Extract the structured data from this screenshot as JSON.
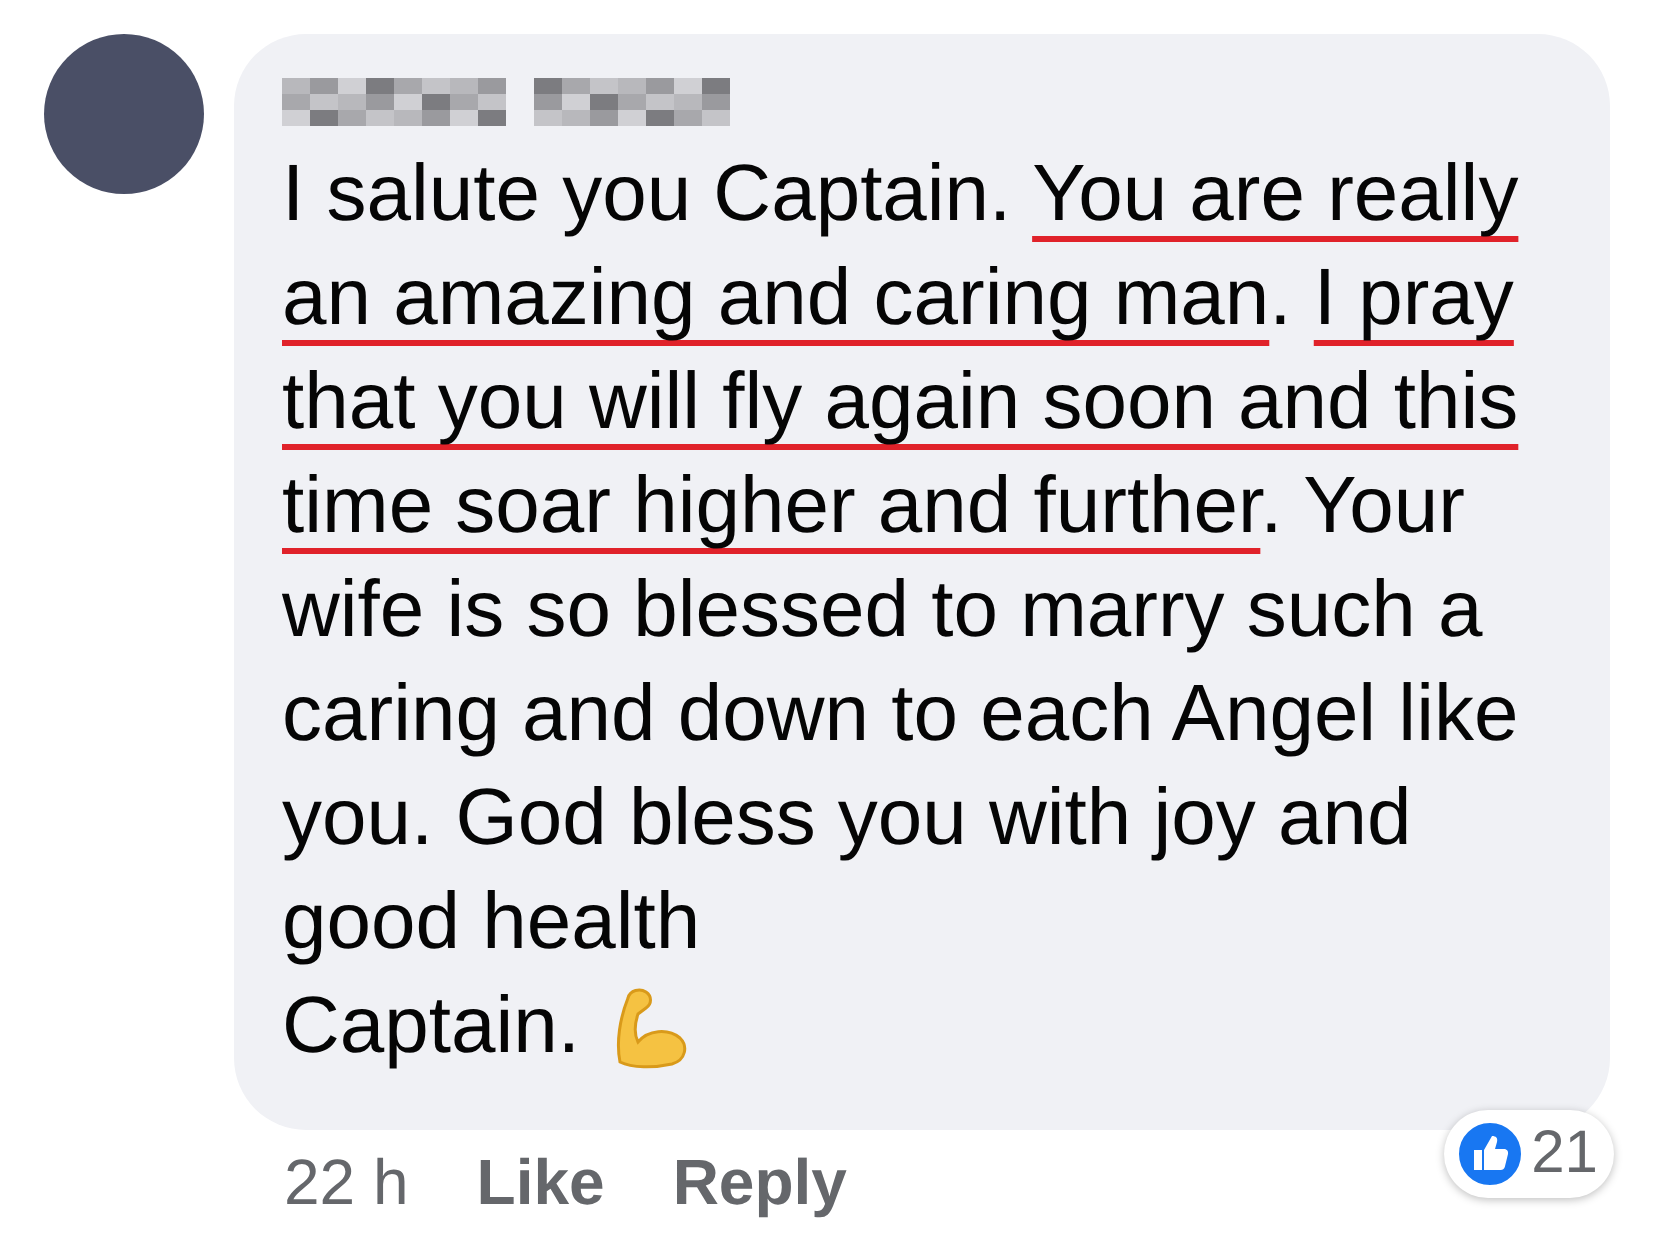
{
  "comment": {
    "segments": [
      {
        "text": "I salute you Captain. ",
        "underlined": false
      },
      {
        "text": "You are really an amazing and caring man",
        "underlined": true
      },
      {
        "text": ". ",
        "underlined": false
      },
      {
        "text": "I pray that you will fly again soon and this time soar higher and further",
        "underlined": true
      },
      {
        "text": ". Your wife is so blessed to marry such a caring and down to each Angel like you. God bless you with joy and good health",
        "underlined": false
      }
    ],
    "last_line": "Captain.",
    "reactions": {
      "count": "21"
    },
    "actions": [
      {
        "kind": "time",
        "label": "22 h"
      },
      {
        "kind": "action",
        "label": "Like"
      },
      {
        "kind": "action",
        "label": "Reply"
      }
    ]
  }
}
